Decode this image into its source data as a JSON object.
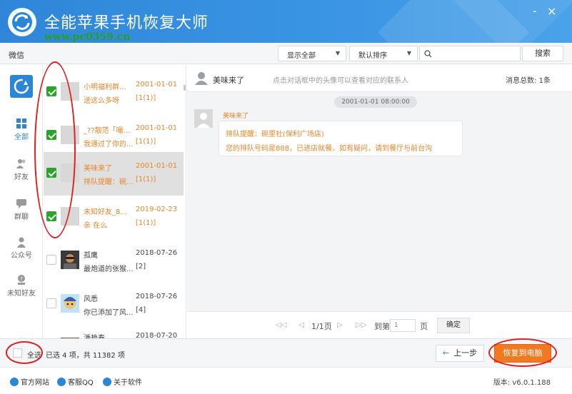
{
  "window": {
    "title": "全能苹果手机恢复大师",
    "watermark": "www.pc0359.cn",
    "minimize_label": "-",
    "close_label": "×"
  },
  "toolbar": {
    "crumb": "微信",
    "filter_label": "显示全部",
    "sort_label": "默认排序",
    "search_placeholder": "",
    "search_button": "搜索"
  },
  "nav": {
    "items": [
      {
        "label": "全部",
        "icon": "grid-icon"
      },
      {
        "label": "好友",
        "icon": "friends-icon"
      },
      {
        "label": "群聊",
        "icon": "group-chat-icon"
      },
      {
        "label": "公众号",
        "icon": "official-account-icon"
      },
      {
        "label": "未知好友",
        "icon": "unknown-friend-icon"
      }
    ]
  },
  "conversations": [
    {
      "name": "小明福利群...",
      "date": "2001-01-01",
      "preview": "送这么多呀",
      "count": "[1(1)]",
      "checked": true
    },
    {
      "name": "_??靓范「嘬...",
      "date": "2001-01-01",
      "preview": "我通过了你的...",
      "count": "[1(1)]",
      "checked": true
    },
    {
      "name": "美味来了",
      "date": "2001-01-01",
      "preview": "排队提醒：碗...",
      "count": "[1(1)]",
      "checked": true
    },
    {
      "name": "未知好友_8...",
      "date": "2019-02-23",
      "preview": "亲 在么",
      "count": "[1(1)]",
      "checked": true
    },
    {
      "name": "孤鹰",
      "date": "2018-07-26",
      "preview": "最炮道的张猴...",
      "count": "[2]",
      "checked": false
    },
    {
      "name": "风悉",
      "date": "2018-07-26",
      "preview": "你已添加了风...",
      "count": "[4]",
      "checked": false
    },
    {
      "name": "潘艳春",
      "date": "2018-07-20",
      "preview": "",
      "count": "",
      "checked": false
    }
  ],
  "chat": {
    "contact": "美味来了",
    "hint": "点击对话框中的头像可以查看对应的联系人",
    "total": "消息总数: 1条",
    "date": "2001-01-01 08:00:00",
    "sender": "美味来了",
    "line1": "排队提醒：碗里社(保利广场店)",
    "line2": "您的排队号码是888，已进店就餐。如有疑问，请到餐厅与前台沟"
  },
  "pager": {
    "first": "◁◁",
    "prev": "◁",
    "page": "1/1页",
    "next": "▷",
    "last": "▷▷",
    "goto": "到第",
    "page_input": "1",
    "page_unit": "页",
    "confirm": "确定"
  },
  "actions": {
    "select_all": "全选",
    "selection_info": "已选 4 项，共 11382 项",
    "prev_step": "上一步",
    "recover": "恢复到电脑"
  },
  "footer": {
    "links": [
      "官方网站",
      "客服QQ",
      "关于软件"
    ],
    "version": "版本: v6.0.1.188"
  },
  "colors": {
    "title_bar": "#3a94e4",
    "accent_orange": "#f37920",
    "check_green": "#2aa52a",
    "annotation_red": "#e02020"
  }
}
